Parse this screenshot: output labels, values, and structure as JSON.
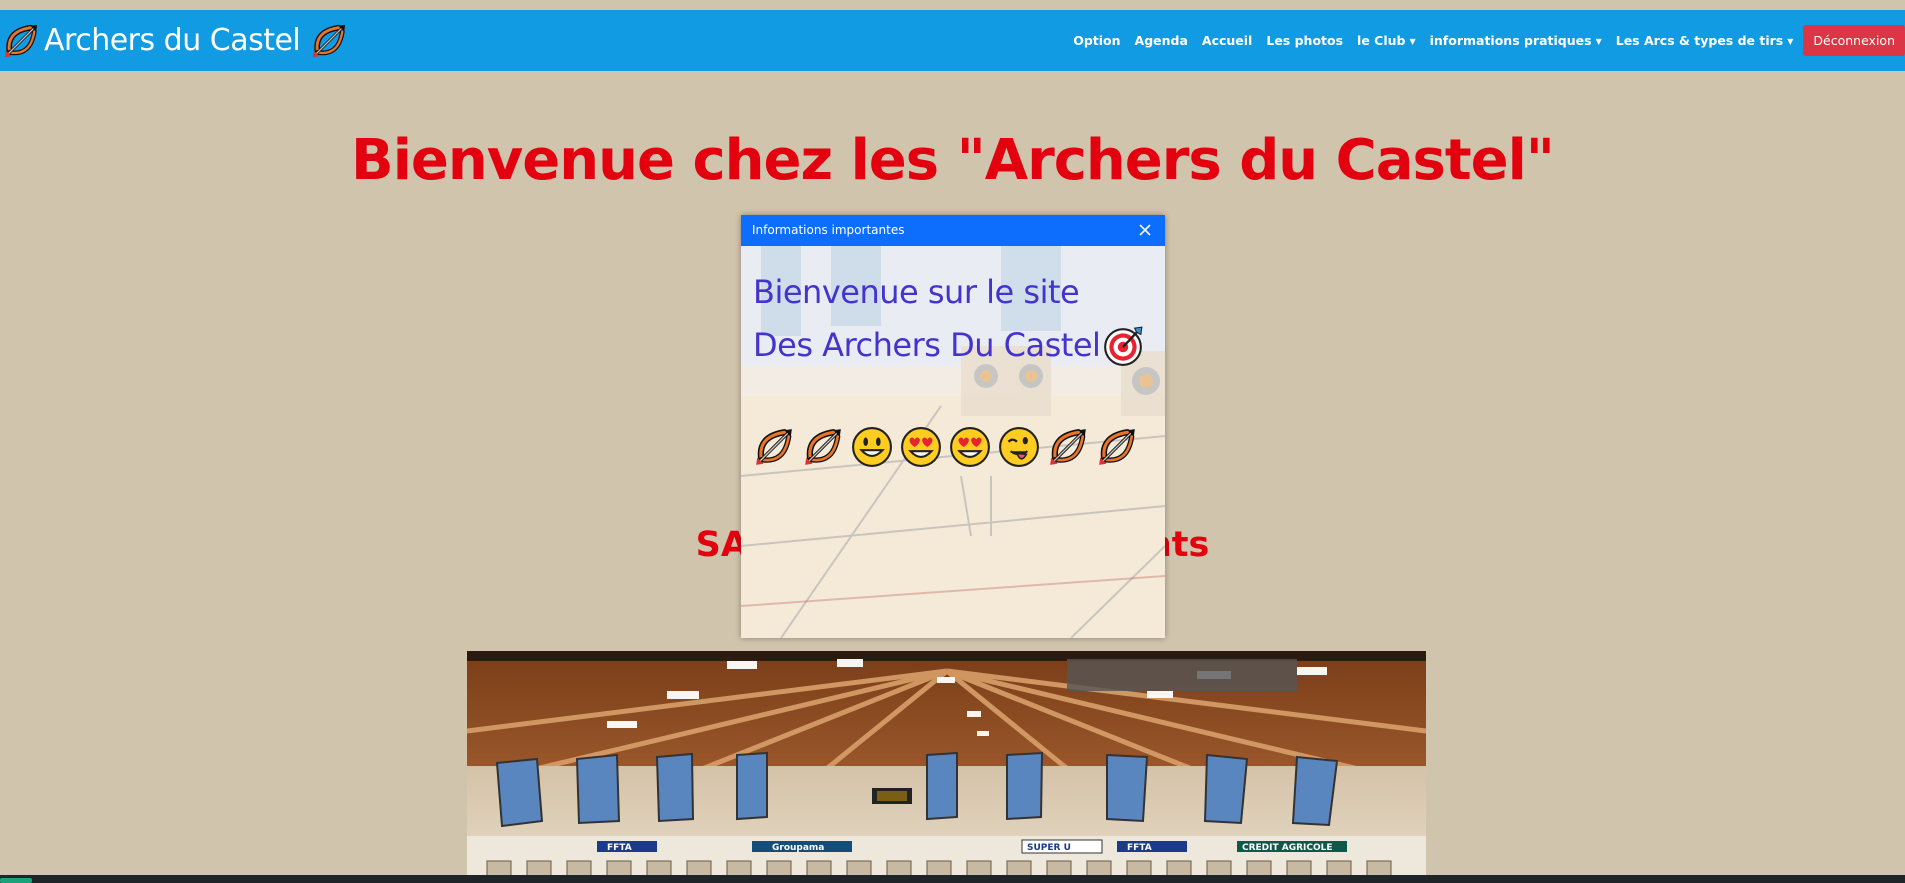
{
  "navbar": {
    "brand": "Archers du Castel",
    "links": [
      {
        "label": "Option",
        "dropdown": false
      },
      {
        "label": "Agenda",
        "dropdown": false
      },
      {
        "label": "Accueil",
        "dropdown": false
      },
      {
        "label": "Les photos",
        "dropdown": false
      },
      {
        "label": "le Club",
        "dropdown": true
      },
      {
        "label": "informations pratiques",
        "dropdown": true
      },
      {
        "label": "Les Arcs & types de tirs",
        "dropdown": true
      }
    ],
    "logout_label": "Déconnexion",
    "caret": "▼"
  },
  "main": {
    "title": "Bienvenue chez les \"Archers du Castel\"",
    "season_left": "SAISO",
    "season_right": "rents"
  },
  "modal": {
    "title": "Informations importantes",
    "line1": "Bienvenue sur le site",
    "line2": "Des Archers Du Castel",
    "emojis": [
      "bow-and-arrow",
      "bow-and-arrow",
      "grinning-face",
      "heart-eyes",
      "heart-eyes",
      "winking-tongue",
      "bow-and-arrow",
      "bow-and-arrow"
    ]
  },
  "hall_banners": [
    "FFTA",
    "Groupama",
    "SUPER U",
    "FFTA",
    "CREDIT AGRICOLE"
  ],
  "colors": {
    "navbar": "#119be2",
    "page_bg": "#d1c4ad",
    "title_red": "#e3000f",
    "logout_red": "#dc3545",
    "modal_header": "#0d6efd",
    "modal_text": "#4433cc"
  }
}
